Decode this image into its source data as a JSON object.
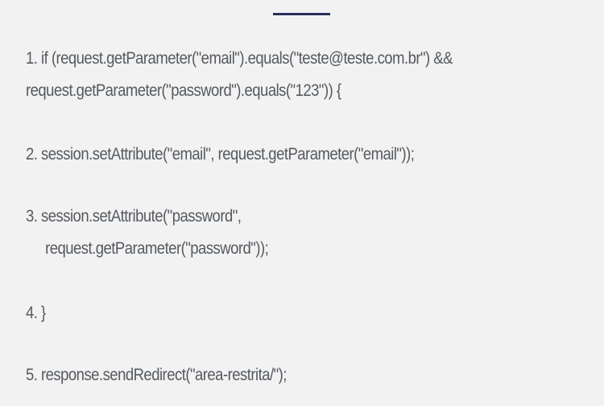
{
  "accent_color": "#2c2f5c",
  "text_color": "#555a60",
  "background_color": "#f2f2f2",
  "code_lines": [
    {
      "line1": "1. if (request.getParameter(\"email\").equals(\"teste@teste.com.br\") &&",
      "line2": "request.getParameter(\"password\").equals(\"123\")) {"
    },
    {
      "line1": "2. session.setAttribute(\"email\", request.getParameter(\"email\"));"
    },
    {
      "line1": "3. session.setAttribute(\"password\",",
      "line2": "request.getParameter(\"password\"));"
    },
    {
      "line1": "4. }"
    },
    {
      "line1": "5. response.sendRedirect(\"area-restrita/\");"
    }
  ]
}
